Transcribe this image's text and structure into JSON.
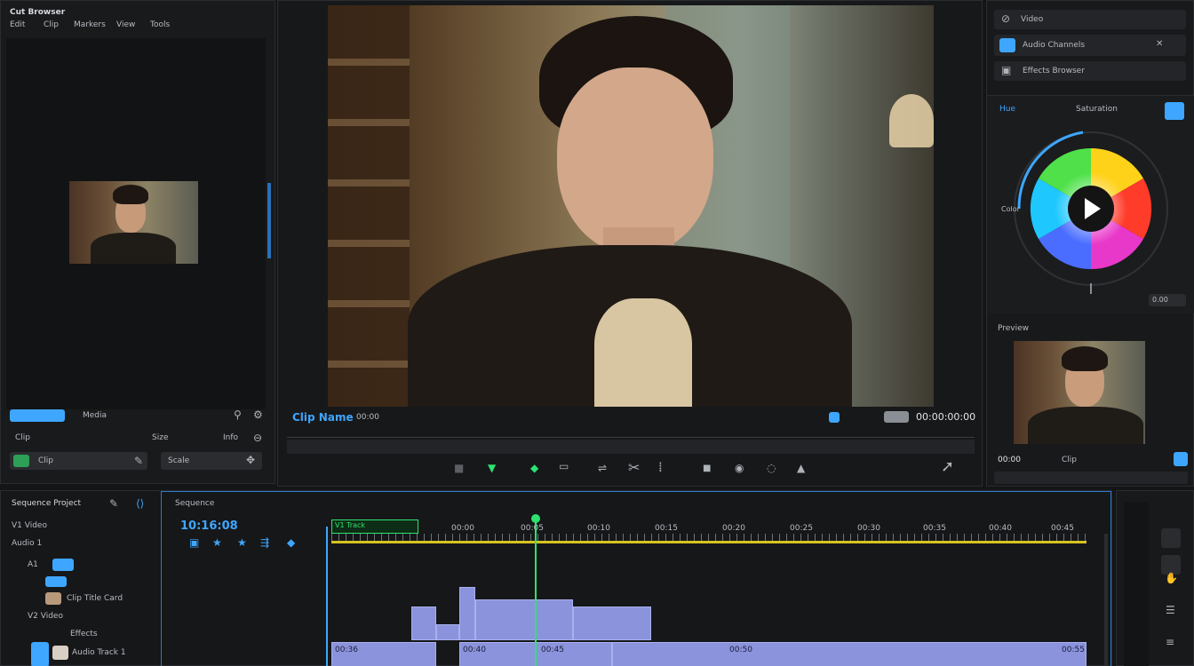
{
  "left_panel": {
    "title": "Cut Browser",
    "menu": [
      "Edit",
      "Clip",
      "Markers",
      "View",
      "Tools"
    ],
    "bottom_label": "Media",
    "row_labels": [
      "Clip",
      "Size",
      "Info"
    ],
    "field_value": "Clip",
    "field_value_2": "Scale"
  },
  "viewer": {
    "timecode_label": "Clip Name",
    "timecode_sub": "00:00",
    "readout": "00:00:00:00"
  },
  "right_panel": {
    "rows": [
      "Video",
      "Audio Channels",
      "Effects Browser"
    ],
    "color_header": [
      "Hue",
      "Saturation"
    ],
    "wheel_label": "Color",
    "wheel_value": "0.00",
    "preview_label": "Preview",
    "preview_footer": [
      "00:00",
      "Clip"
    ]
  },
  "timeline": {
    "left_header": "Sequence Project",
    "tracks": [
      {
        "name": "V1 Video"
      },
      {
        "name": "Audio 1"
      },
      {
        "name": "A1"
      },
      {
        "name": "Clip Title Card"
      },
      {
        "name": "V2 Video"
      },
      {
        "name": "Effects"
      },
      {
        "name": "Audio Track 1"
      }
    ],
    "timecode": "10:16:08",
    "ruler_labels": [
      "00:00",
      "00:05",
      "00:10",
      "00:15",
      "00:20",
      "00:25",
      "00:30",
      "00:35",
      "00:40",
      "00:45"
    ],
    "audio_labels": [
      "00:36",
      "00:40",
      "00:45",
      "00:50",
      "00:55"
    ],
    "green_label": "V1 Track",
    "header_label": "Sequence",
    "accent": "#3ea6ff",
    "playhead_color": "#2de36f",
    "clip_color": "#8b93dc"
  }
}
